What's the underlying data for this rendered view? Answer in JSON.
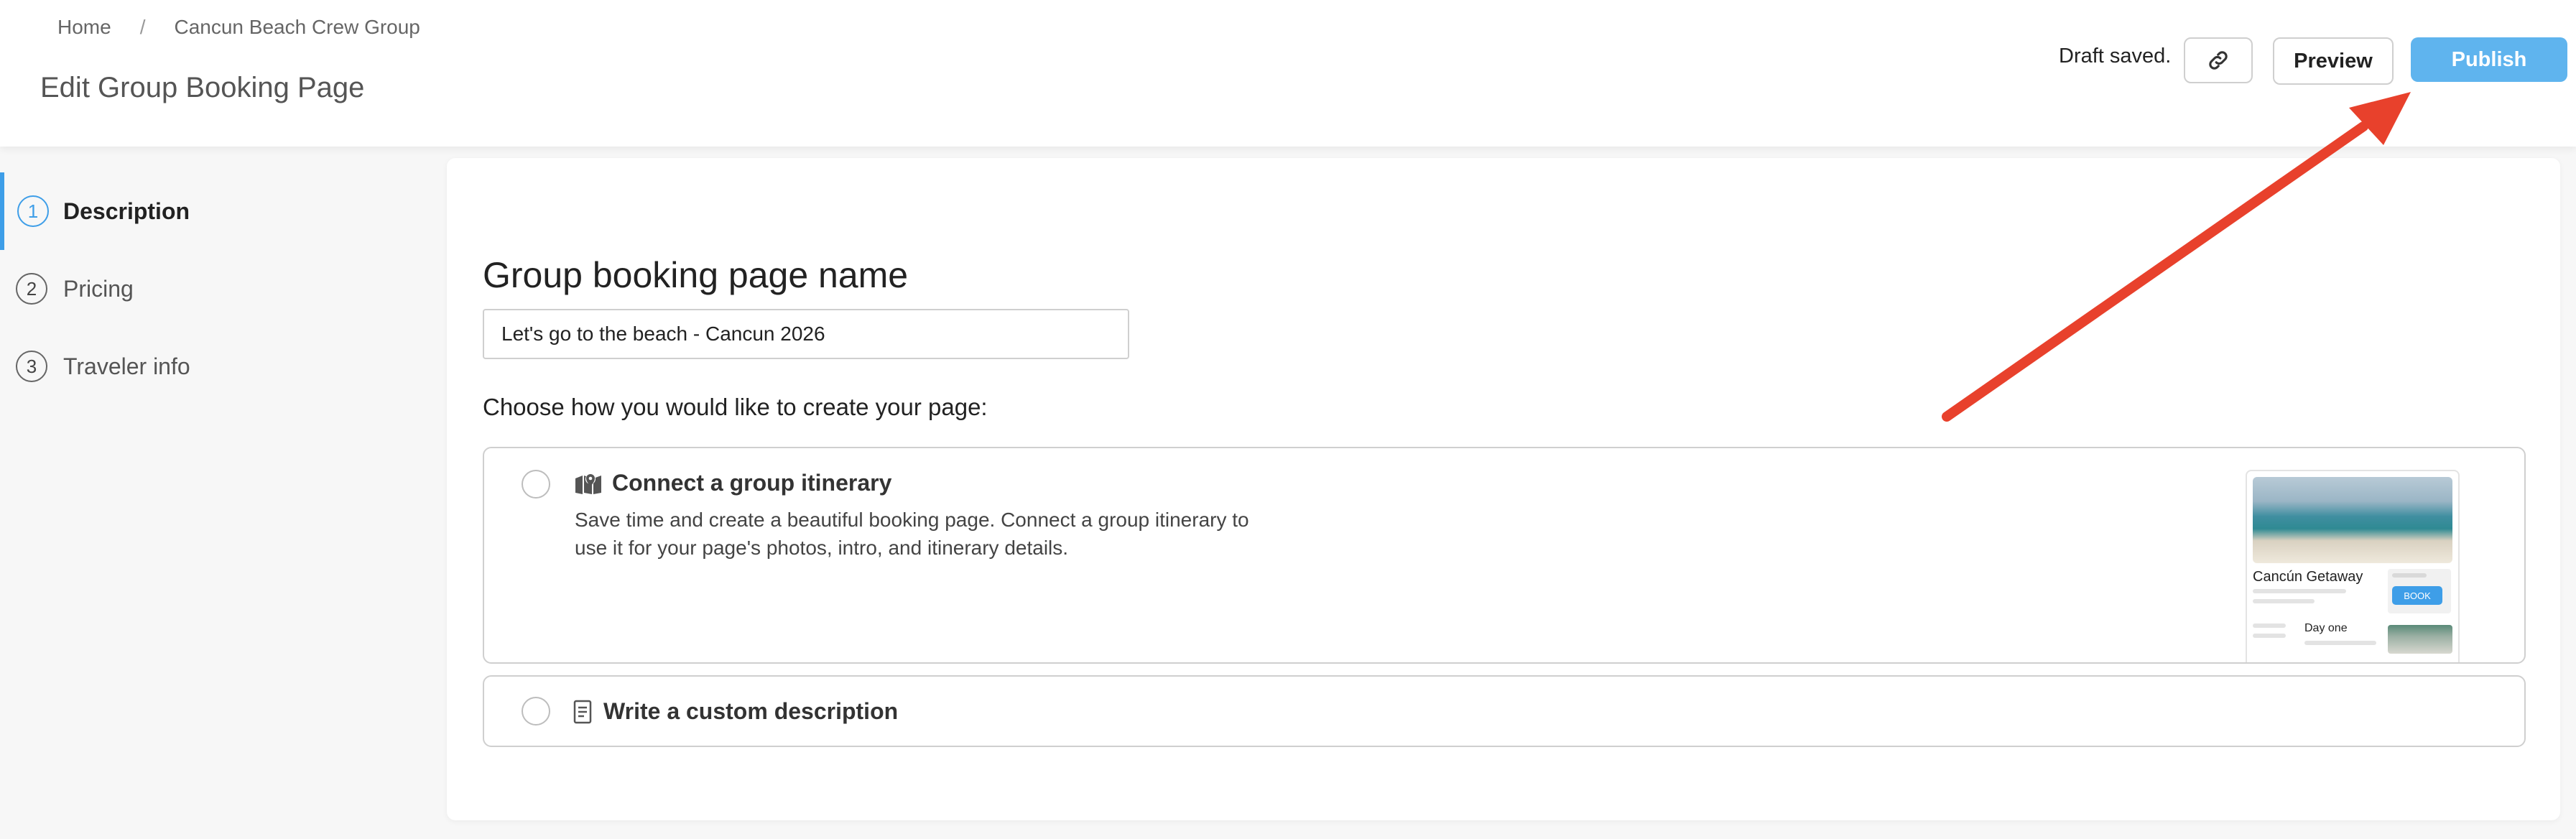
{
  "breadcrumb": {
    "home": "Home",
    "separator": "/",
    "current": "Cancun Beach Crew Group"
  },
  "page_title": "Edit Group Booking Page",
  "header_actions": {
    "draft_status": "Draft saved.",
    "link_icon": "link-icon",
    "preview_label": "Preview",
    "publish_label": "Publish"
  },
  "steps": [
    {
      "number": "1",
      "label": "Description",
      "active": true
    },
    {
      "number": "2",
      "label": "Pricing",
      "active": false
    },
    {
      "number": "3",
      "label": "Traveler info",
      "active": false
    }
  ],
  "form": {
    "section_title": "Group booking page name",
    "name_value": "Let's go to the beach - Cancun 2026",
    "choose_label": "Choose how you would like to create your page:"
  },
  "options": [
    {
      "icon": "map-icon",
      "title": "Connect a group itinerary",
      "description": "Save time and create a beautiful booking page. Connect a group itinerary to use it for your page's photos, intro, and itinerary details.",
      "preview": {
        "title": "Cancún Getaway",
        "book_label": "BOOK",
        "day_label": "Day one"
      }
    },
    {
      "icon": "document-icon",
      "title": "Write a custom description"
    }
  ],
  "colors": {
    "accent": "#3e9ee8",
    "publish": "#5fb4ee",
    "annotation_arrow": "#e8412c"
  }
}
